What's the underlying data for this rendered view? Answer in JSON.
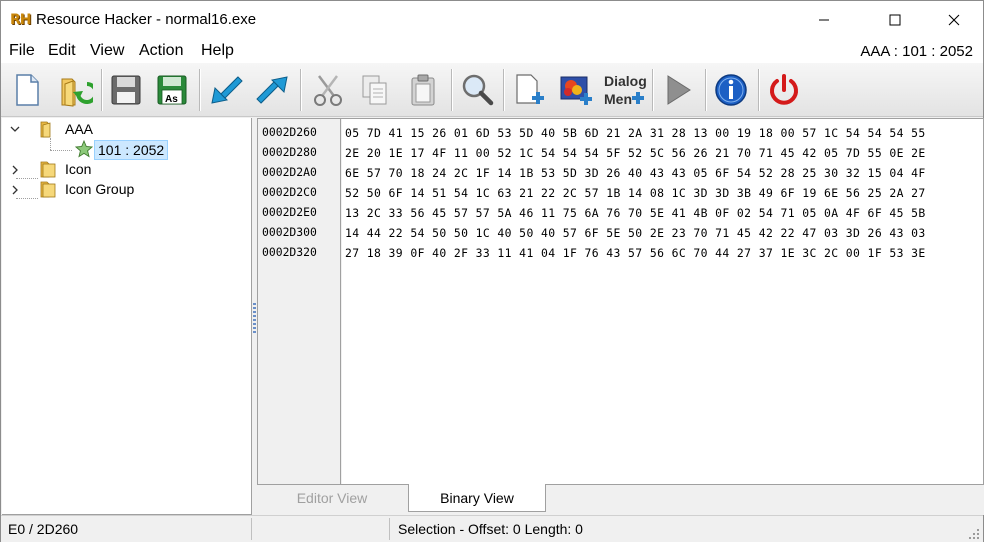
{
  "window": {
    "title": "Resource Hacker - normal16.exe",
    "logo_text": "RH"
  },
  "menu": {
    "items": [
      {
        "label": "File"
      },
      {
        "label": "Edit"
      },
      {
        "label": "View"
      },
      {
        "label": "Action"
      },
      {
        "label": "Help"
      }
    ],
    "resource_indicator": "AAA : 101 : 2052"
  },
  "toolbar": {
    "buttons": [
      {
        "icon": "new-file-icon"
      },
      {
        "icon": "open-folder-icon"
      },
      {
        "icon": "save-icon"
      },
      {
        "icon": "save-as-icon",
        "badge": "As"
      },
      {
        "icon": "compile-back-arrow-icon"
      },
      {
        "icon": "compile-forward-arrow-icon"
      },
      {
        "icon": "cut-icon"
      },
      {
        "icon": "copy-icon"
      },
      {
        "icon": "paste-icon"
      },
      {
        "icon": "find-icon"
      },
      {
        "icon": "add-resource-icon"
      },
      {
        "icon": "add-image-resource-icon"
      },
      {
        "icon": "dialog-menu-icon",
        "text_top": "Dialog",
        "text_bottom": "Men"
      },
      {
        "icon": "play-script-icon"
      },
      {
        "icon": "info-icon"
      },
      {
        "icon": "power-icon"
      }
    ]
  },
  "tree": {
    "nodes": [
      {
        "label": "AAA",
        "expanded": true
      },
      {
        "label": "101 : 2052",
        "selected": true
      },
      {
        "label": "Icon",
        "expanded": false
      },
      {
        "label": "Icon Group",
        "expanded": false
      }
    ]
  },
  "hex": {
    "offsets": [
      "0002D260",
      "0002D280",
      "0002D2A0",
      "0002D2C0",
      "0002D2E0",
      "0002D300",
      "0002D320"
    ],
    "lines": [
      "05 7D 41 15 26 01 6D 53 5D 40 5B 6D 21 2A 31 28 13 00 19 18 00 57 1C 54 54 54 55",
      "2E 20 1E 17 4F 11 00 52 1C 54 54 54 5F 52 5C 56 26 21 70 71 45 42 05 7D 55 0E 2E",
      "6E 57 70 18 24 2C 1F 14 1B 53 5D 3D 26 40 43 43 05 6F 54 52 28 25 30 32 15 04 4F",
      "52 50 6F 14 51 54 1C 63 21 22 2C 57 1B 14 08 1C 3D 3D 3B 49 6F 19 6E 56 25 2A 27",
      "13 2C 33 56 45 57 57 5A 46 11 75 6A 76 70 5E 41 4B 0F 02 54 71 05 0A 4F 6F 45 5B",
      "14 44 22 54 50 50 1C 40 50 40 57 6F 5E 50 2E 23 70 71 45 42 22 47 03 3D 26 43 03",
      "27 18 39 0F 40 2F 33 11 41 04 1F 76 43 57 56 6C 70 44 27 37 1E 3C 2C 00 1F 53 3E"
    ]
  },
  "tabs": {
    "editor": "Editor View",
    "binary": "Binary View",
    "active": "binary"
  },
  "status": {
    "position": "E0 / 2D260",
    "selection": "Selection - Offset: 0 Length: 0"
  }
}
